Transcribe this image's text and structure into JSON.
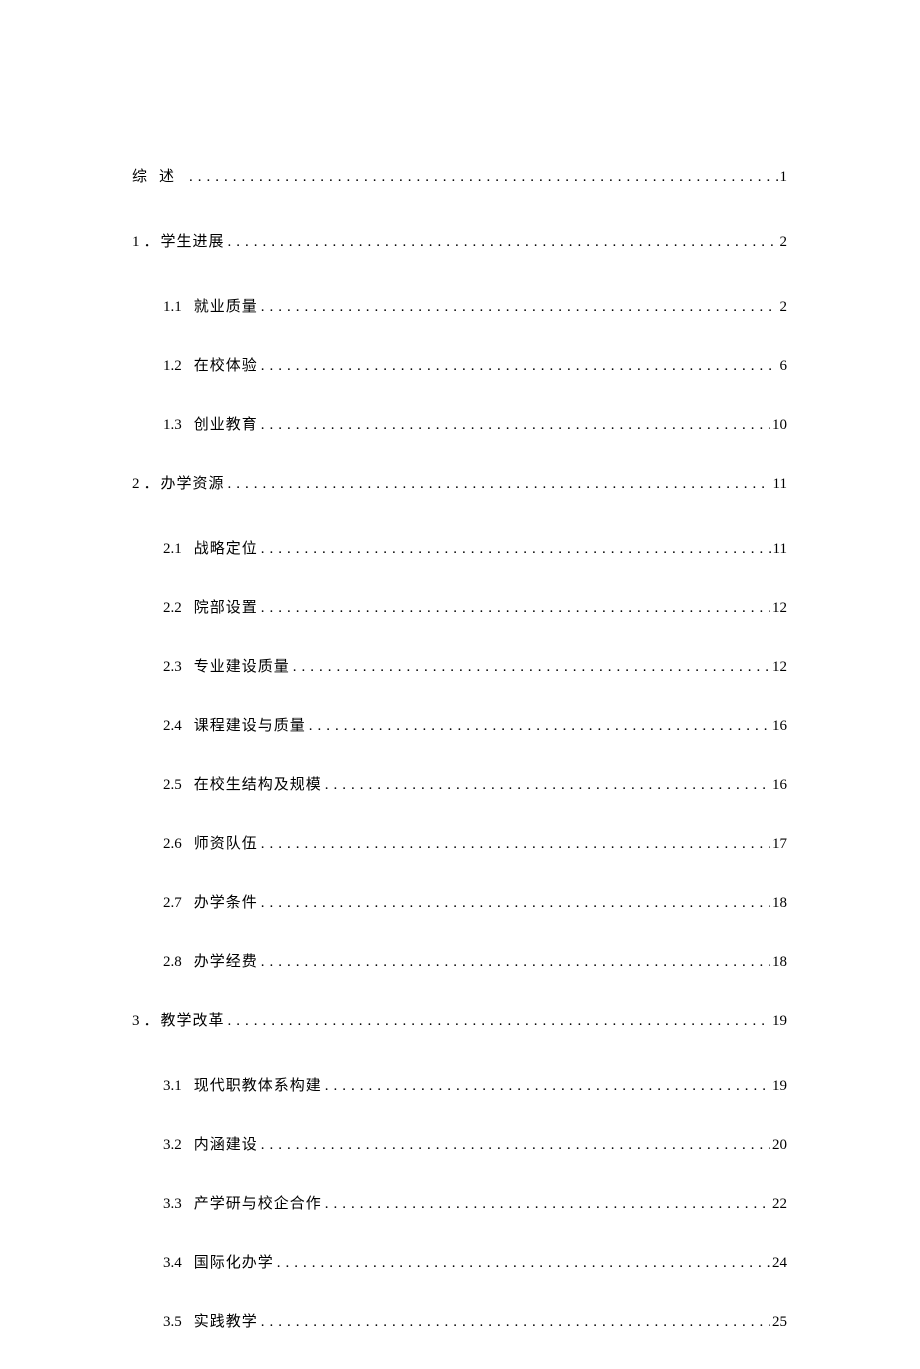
{
  "toc": [
    {
      "level": 0,
      "num": "",
      "title": "综述",
      "page": "1",
      "summary": true
    },
    {
      "level": 0,
      "num": "1",
      "title": "学生进展",
      "page": "2"
    },
    {
      "level": 1,
      "num": "1.1",
      "title": "就业质量",
      "page": "2"
    },
    {
      "level": 1,
      "num": "1.2",
      "title": "在校体验",
      "page": "6"
    },
    {
      "level": 1,
      "num": "1.3",
      "title": "创业教育",
      "page": "10"
    },
    {
      "level": 0,
      "num": "2",
      "title": "办学资源",
      "page": "11"
    },
    {
      "level": 1,
      "num": "2.1",
      "title": "战略定位",
      "page": "11"
    },
    {
      "level": 1,
      "num": "2.2",
      "title": "院部设置",
      "page": "12"
    },
    {
      "level": 1,
      "num": "2.3",
      "title": "专业建设质量",
      "page": "12"
    },
    {
      "level": 1,
      "num": "2.4",
      "title": "课程建设与质量",
      "page": "16"
    },
    {
      "level": 1,
      "num": "2.5",
      "title": "在校生结构及规模",
      "page": "16"
    },
    {
      "level": 1,
      "num": "2.6",
      "title": "师资队伍",
      "page": "17"
    },
    {
      "level": 1,
      "num": "2.7",
      "title": "办学条件",
      "page": "18"
    },
    {
      "level": 1,
      "num": "2.8",
      "title": "办学经费",
      "page": "18"
    },
    {
      "level": 0,
      "num": "3",
      "title": "教学改革",
      "page": "19"
    },
    {
      "level": 1,
      "num": "3.1",
      "title": "现代职教体系构建",
      "page": "19"
    },
    {
      "level": 1,
      "num": "3.2",
      "title": "内涵建设",
      "page": "20"
    },
    {
      "level": 1,
      "num": "3.3",
      "title": "产学研与校企合作",
      "page": "22"
    },
    {
      "level": 1,
      "num": "3.4",
      "title": "国际化办学",
      "page": "24"
    },
    {
      "level": 1,
      "num": "3.5",
      "title": "实践教学",
      "page": "25"
    }
  ]
}
